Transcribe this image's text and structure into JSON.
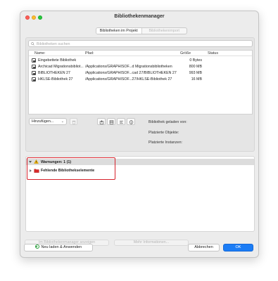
{
  "window": {
    "title": "Bibliothekenmanager"
  },
  "tabs": [
    {
      "label": "Bibliotheken im Projekt",
      "active": true
    },
    {
      "label": "Bibliothekenimport",
      "active": false
    }
  ],
  "search": {
    "placeholder": "Bibliotheken suchen"
  },
  "table": {
    "headers": {
      "name": "Name:",
      "path": "Pfad:",
      "size": "Größe",
      "status": "Status"
    },
    "rows": [
      {
        "name": "Eingebettete Bibliothek",
        "path": "",
        "size": "0 Bytes",
        "status": ""
      },
      {
        "name": "Archicad Migrationsbibliot...",
        "path": "/Applications/GRAPHISOF...d Migrationsbibliotheken",
        "size": "800 MB",
        "status": ""
      },
      {
        "name": "BIBLIOTHEKEN 27",
        "path": "/Applications/GRAPHISOF...cad 27/BIBLIOTHEKEN 27",
        "size": "993 MB",
        "status": ""
      },
      {
        "name": "HKLSE-Bibliothek 27",
        "path": "/Applications/GRAPHISOF...27/HKLSE-Bibliothek 27",
        "size": "16 MB",
        "status": ""
      }
    ]
  },
  "toolbar": {
    "add_label": "Hinzufügen..."
  },
  "info": {
    "loaded_from": "Bibliothek geladen von:",
    "placed_objects": "Platzierte Objekte:",
    "placed_instances": "Platzierte Instanzen:"
  },
  "warnings": {
    "header": "Warnungen: 1 (1)",
    "items": [
      {
        "label": "Fehlende Bibliothekselemente"
      }
    ]
  },
  "lower_buttons": {
    "show_in_manager": "Im Bibliothekenmanager anzeigen",
    "more_info": "Mehr Informationen..."
  },
  "footer": {
    "reload": "Neu laden & Anwenden",
    "cancel": "Abbrechen",
    "ok": "OK"
  },
  "colors": {
    "accent": "#1b7cf5",
    "highlight": "#d6212b",
    "warning": "#f2b400",
    "folder": "#d62b2b"
  }
}
